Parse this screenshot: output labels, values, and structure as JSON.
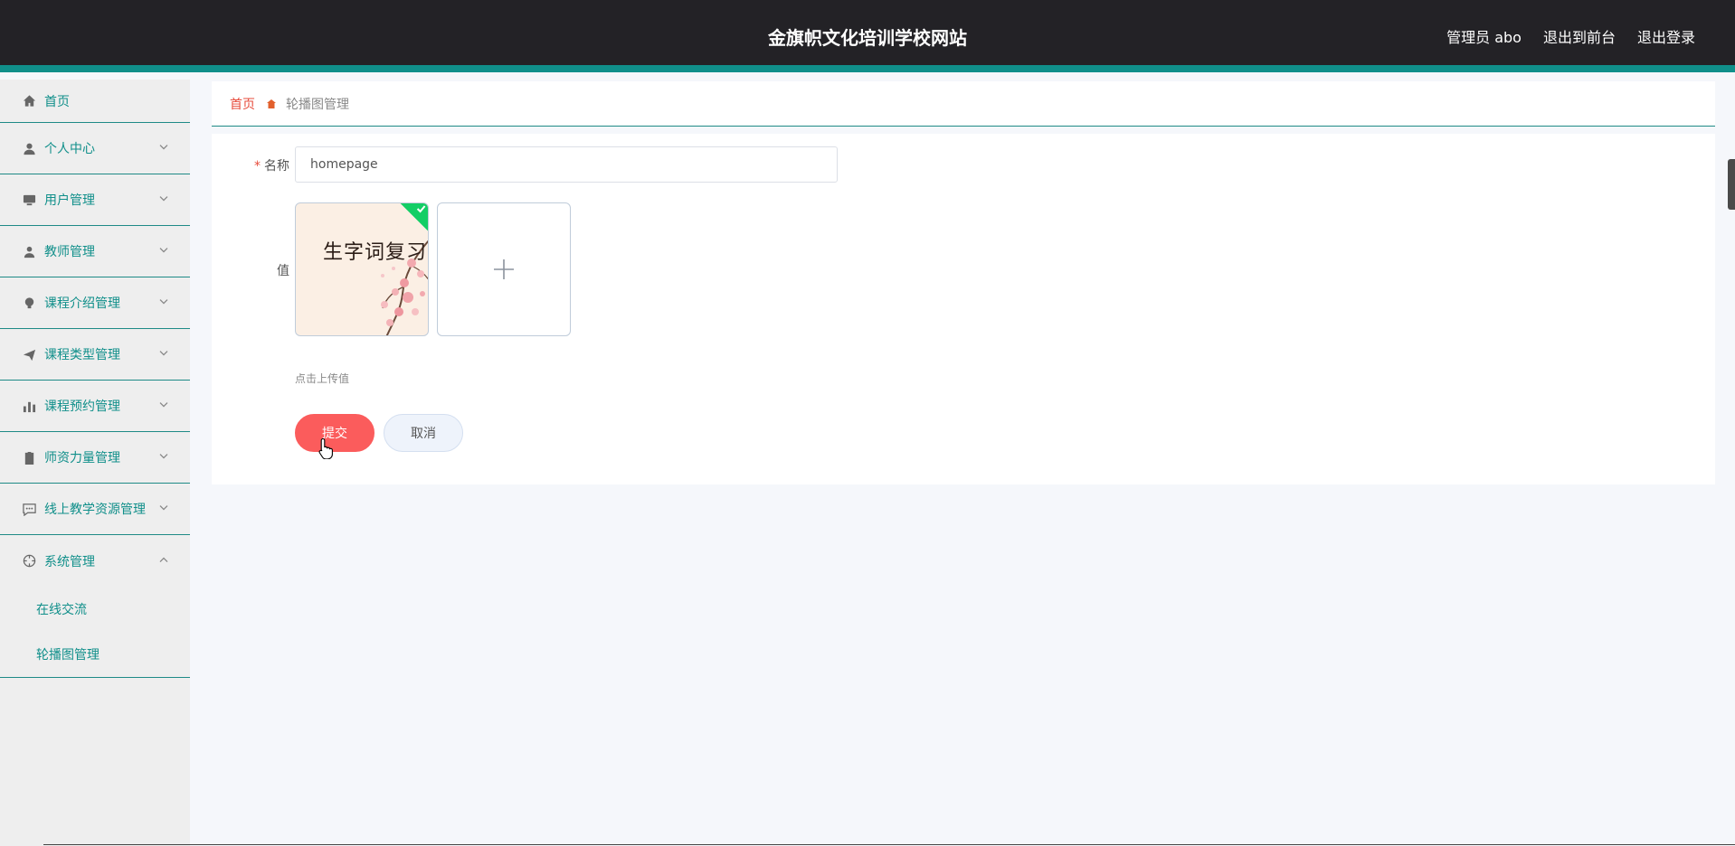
{
  "header": {
    "title": "金旗帜文化培训学校网站",
    "admin_label": "管理员 abo",
    "front_link": "退出到前台",
    "logout_link": "退出登录"
  },
  "sidebar": {
    "items": [
      {
        "label": "首页",
        "icon": "home-icon"
      },
      {
        "label": "个人中心",
        "icon": "user-icon"
      },
      {
        "label": "用户管理",
        "icon": "monitor-icon"
      },
      {
        "label": "教师管理",
        "icon": "teacher-icon"
      },
      {
        "label": "课程介绍管理",
        "icon": "bulb-icon"
      },
      {
        "label": "课程类型管理",
        "icon": "send-icon"
      },
      {
        "label": "课程预约管理",
        "icon": "bar-chart-icon"
      },
      {
        "label": "师资力量管理",
        "icon": "clipboard-icon"
      },
      {
        "label": "线上教学资源管理",
        "icon": "chat-icon"
      },
      {
        "label": "系统管理",
        "icon": "crosshair-icon"
      }
    ],
    "subitems": [
      {
        "label": "在线交流"
      },
      {
        "label": "轮播图管理"
      }
    ]
  },
  "breadcrumb": {
    "home": "首页",
    "current": "轮播图管理"
  },
  "form": {
    "name_label": "名称",
    "name_value": "homepage",
    "value_label": "值",
    "thumb_text": "生字词复习",
    "upload_hint": "点击上传值",
    "submit_label": "提交",
    "cancel_label": "取消"
  },
  "colors": {
    "header_bg": "#232226",
    "accent": "#108f8a",
    "submit": "#fb5c5c",
    "success": "#13ce66"
  }
}
